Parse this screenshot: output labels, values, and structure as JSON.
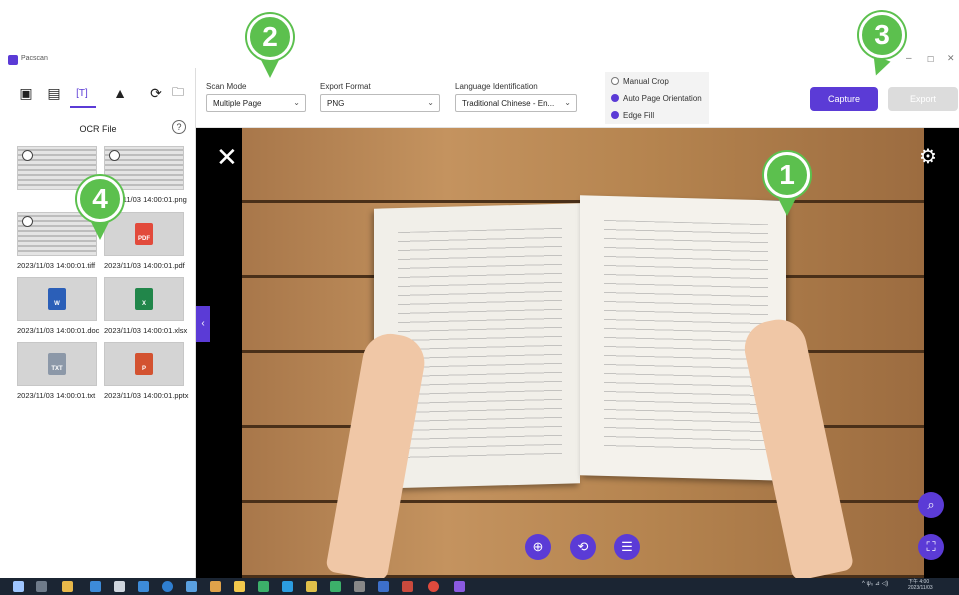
{
  "window": {
    "title": "Pacscan",
    "minimize": "–",
    "restore": "☐",
    "close": "✕"
  },
  "sidebar": {
    "tabs": [
      {
        "name": "image-tab",
        "icon": "image-icon",
        "glyph": "▣"
      },
      {
        "name": "video-tab",
        "icon": "video-icon",
        "glyph": "▤"
      },
      {
        "name": "ocr-tab",
        "icon": "ocr-text-icon",
        "glyph": "[T]"
      },
      {
        "name": "drive-tab",
        "icon": "drive-icon",
        "glyph": "▲"
      },
      {
        "name": "refresh-tab",
        "icon": "refresh-icon",
        "glyph": "⟳"
      },
      {
        "name": "folder-tab",
        "icon": "folder-icon",
        "glyph": "🗀"
      }
    ],
    "title": "OCR File",
    "help": "?",
    "files": [
      {
        "name": "",
        "kind": "photo"
      },
      {
        "name": "2023/11/03 14:00:01.png",
        "kind": "photo"
      },
      {
        "name": "2023/11/03 14:00:01.tiff",
        "kind": "photo"
      },
      {
        "name": "2023/11/03 14:00:01.pdf",
        "kind": "pdf",
        "badge": "PDF",
        "color": "#e24a3b"
      },
      {
        "name": "2023/11/03 14:00:01.doc",
        "kind": "doc",
        "badge": "W",
        "color": "#2b5fb8"
      },
      {
        "name": "2023/11/03 14:00:01.xlsx",
        "kind": "xlsx",
        "badge": "X",
        "color": "#21864a"
      },
      {
        "name": "2023/11/03 14:00:01.txt",
        "kind": "txt",
        "badge": "TXT",
        "color": "#8c98a8"
      },
      {
        "name": "2023/11/03 14:00:01.pptx",
        "kind": "pptx",
        "badge": "P",
        "color": "#d35230"
      }
    ]
  },
  "toolbar": {
    "scan_mode": {
      "label": "Scan Mode",
      "value": "Multiple Page"
    },
    "export_format": {
      "label": "Export Format",
      "value": "PNG"
    },
    "language": {
      "label": "Language Identification",
      "value": "Traditional Chinese - En..."
    },
    "options": [
      {
        "label": "Manual Crop",
        "checked": false
      },
      {
        "label": "Auto Page Orientation",
        "checked": true
      },
      {
        "label": "Edge Fill",
        "checked": true
      }
    ],
    "capture_label": "Capture",
    "export_label": "Export"
  },
  "preview": {
    "close_glyph": "✕",
    "settings_glyph": "⚙",
    "collapse_glyph": "‹",
    "focus_glyph": "⊕",
    "rotate_glyph": "⟲",
    "adjust_glyph": "☰",
    "zoom_glyph": "⌕",
    "fit_glyph": "⛶"
  },
  "markers": [
    "1",
    "2",
    "3",
    "4"
  ],
  "taskbar": {
    "clock": "下午 4:00\n2023/11/03",
    "tray": "^ ψ₀ ⊿ ◁)"
  },
  "colors": {
    "accent": "#5b3bd6",
    "marker": "#5cc04e",
    "taskbar": "#1b2533"
  }
}
